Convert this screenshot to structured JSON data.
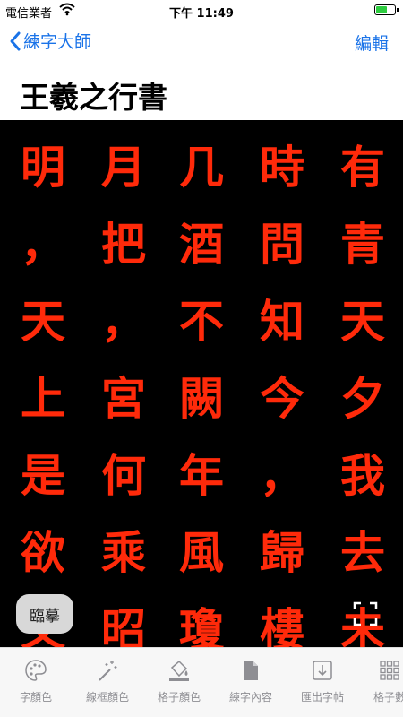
{
  "status": {
    "carrier": "電信業者",
    "time": "下午 11:49"
  },
  "nav": {
    "back_label": "練字大師",
    "edit_label": "編輯"
  },
  "title": "王羲之行書",
  "columns": [
    [
      "有",
      "青",
      "天",
      "夕",
      "我",
      "去",
      "未"
    ],
    [
      "時",
      "問",
      "知",
      "今",
      "，",
      "歸",
      "樓"
    ],
    [
      "几",
      "酒",
      "不",
      "闕",
      "年",
      "風",
      "瓊"
    ],
    [
      "月",
      "把",
      "，",
      "宮",
      "何",
      "乘",
      "昭"
    ],
    [
      "明",
      "，",
      "天",
      "上",
      "是",
      "欲",
      "又"
    ]
  ],
  "trace_button": "臨摹",
  "tabs": [
    {
      "label": "字顏色",
      "icon": "palette-icon"
    },
    {
      "label": "線框顏色",
      "icon": "magic-wand-icon"
    },
    {
      "label": "格子顏色",
      "icon": "paint-bucket-icon"
    },
    {
      "label": "練字內容",
      "icon": "document-icon"
    },
    {
      "label": "匯出字帖",
      "icon": "export-icon"
    },
    {
      "label": "格子數",
      "icon": "grid-icon"
    }
  ],
  "colors": {
    "accent": "#1a73e8",
    "glyph": "#ff2a0a",
    "board": "#000000",
    "battery": "#2ecc40"
  }
}
